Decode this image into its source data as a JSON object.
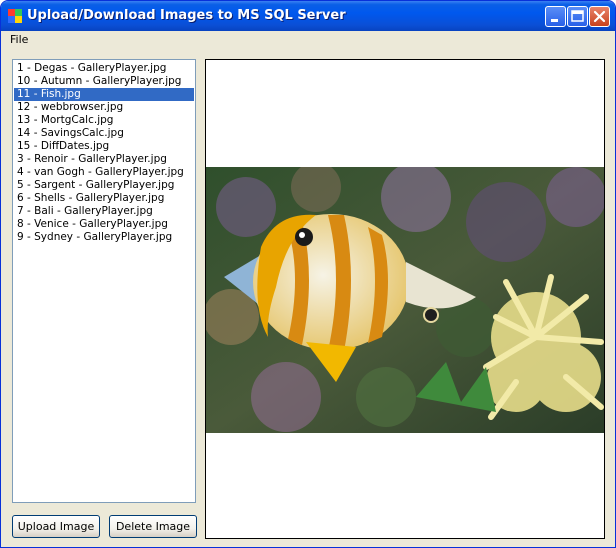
{
  "window": {
    "title": "Upload/Download Images to MS SQL Server"
  },
  "menu": {
    "file_label": "File"
  },
  "images_list": {
    "items": [
      "1 - Degas - GalleryPlayer.jpg",
      "10 - Autumn - GalleryPlayer.jpg",
      "11 - Fish.jpg",
      "12 - webbrowser.jpg",
      "13 - MortgCalc.jpg",
      "14 - SavingsCalc.jpg",
      "15 - DiffDates.jpg",
      "3 - Renoir - GalleryPlayer.jpg",
      "4 - van Gogh - GalleryPlayer.jpg",
      "5 - Sargent - GalleryPlayer.jpg",
      "6 - Shells - GalleryPlayer.jpg",
      "7 - Bali - GalleryPlayer.jpg",
      "8 - Venice - GalleryPlayer.jpg",
      "9 - Sydney - GalleryPlayer.jpg"
    ],
    "selected_index": 2
  },
  "buttons": {
    "upload_label": "Upload Image",
    "delete_label": "Delete Image"
  },
  "colors": {
    "selection": "#316ac5",
    "titlebar": "#0058ee"
  }
}
